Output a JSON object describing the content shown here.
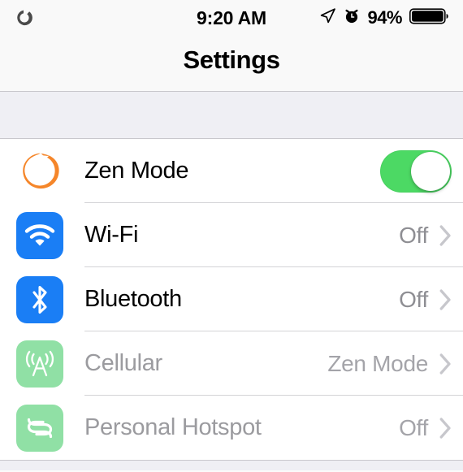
{
  "status_bar": {
    "zen_indicator_icon": "zen-ring-icon",
    "time": "9:20 AM",
    "location_icon": "location-arrow-icon",
    "alarm_icon": "alarm-clock-icon",
    "battery_percent": "94%",
    "battery_icon": "battery-full-icon"
  },
  "nav": {
    "title": "Settings"
  },
  "settings_list": [
    {
      "label": "Zen Mode",
      "icon": "zen-enso-icon",
      "icon_bg": "transparent",
      "control": "toggle",
      "toggle_on": true,
      "toggle_color": "#4cd964",
      "value": "",
      "dimmed": false
    },
    {
      "label": "Wi-Fi",
      "icon": "wifi-icon",
      "icon_bg": "#1a7ef5",
      "control": "disclosure",
      "value": "Off",
      "dimmed": false
    },
    {
      "label": "Bluetooth",
      "icon": "bluetooth-icon",
      "icon_bg": "#1a7ef5",
      "control": "disclosure",
      "value": "Off",
      "dimmed": false
    },
    {
      "label": "Cellular",
      "icon": "cellular-antenna-icon",
      "icon_bg": "#90e0a5",
      "control": "disclosure",
      "value": "Zen Mode",
      "dimmed": true
    },
    {
      "label": "Personal Hotspot",
      "icon": "personal-hotspot-icon",
      "icon_bg": "#90e0a5",
      "control": "disclosure",
      "value": "Off",
      "dimmed": true
    }
  ],
  "colors": {
    "accent_orange": "#f5862a",
    "accent_blue": "#1a7ef5",
    "accent_green": "#4cd964",
    "muted_green": "#90e0a5",
    "value_gray": "#8e8e93",
    "chevron_gray": "#c7c7cc",
    "group_bg": "#efeff4"
  }
}
